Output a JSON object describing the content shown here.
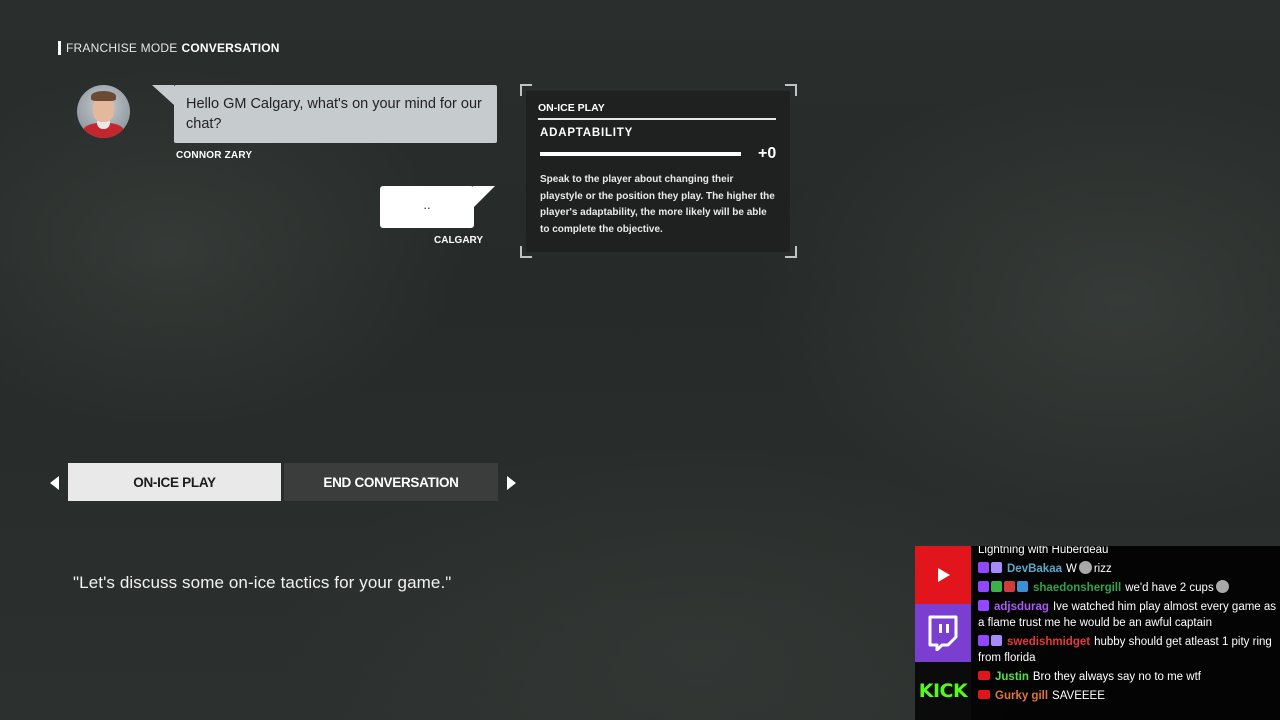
{
  "header": {
    "mode": "FRANCHISE MODE",
    "title": "CONVERSATION"
  },
  "conversation": {
    "npc": {
      "name": "CONNOR ZARY",
      "text": "Hello GM Calgary, what's on your mind for our chat?"
    },
    "player": {
      "name": "CALGARY",
      "text": ".."
    }
  },
  "card": {
    "category": "ON-ICE PLAY",
    "attribute": "ADAPTABILITY",
    "value": "+0",
    "description": "Speak to the player about changing their playstyle or the position they play. The higher the player's adaptability, the more likely will be able to complete the objective."
  },
  "options": [
    {
      "label": "ON-ICE PLAY",
      "selected": true
    },
    {
      "label": "END CONVERSATION",
      "selected": false
    }
  ],
  "preview_line": "\"Let's discuss some on-ice tactics for your game.\"",
  "chat": {
    "platforms": [
      "youtube-icon",
      "twitch-icon",
      "kick-icon"
    ],
    "kick_label": "KICK",
    "messages": [
      {
        "user": "",
        "text": "Lightning with Huberdeau",
        "color": "#ffffff"
      },
      {
        "user": "DevBakaa",
        "text": "W",
        "text2": "rizz",
        "color": "#5aa9c9"
      },
      {
        "user": "shaedonshergill",
        "text": "we'd have 2 cups",
        "color": "#2fa34a"
      },
      {
        "user": "adjsdurag",
        "text": "Ive watched him play almost every game as a flame trust me he would be an awful captain",
        "color": "#a95cf2"
      },
      {
        "user": "swedishmidget",
        "text": "hubby should get atleast 1 pity ring from florida",
        "color": "#e23a3a"
      },
      {
        "user": "Justin",
        "text": "Bro they always say no to me wtf",
        "color": "#53e04a"
      },
      {
        "user": "Gurky gill",
        "text": "SAVEEEE",
        "color": "#e0743a"
      }
    ]
  }
}
